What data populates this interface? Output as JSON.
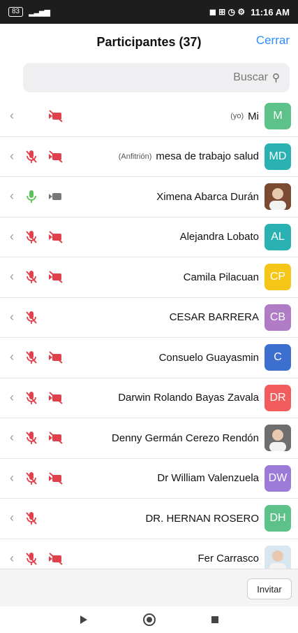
{
  "status_bar": {
    "time": "11:16 AM",
    "battery": "83"
  },
  "header": {
    "title": "Participantes (37)",
    "close_label": "Cerrar"
  },
  "search": {
    "placeholder": "Buscar"
  },
  "participants": [
    {
      "name": "Mi",
      "tag": "(yo)",
      "initials": "M",
      "color": "#5cc28a",
      "mic": "none",
      "video": "off"
    },
    {
      "name": "mesa de trabajo salud",
      "tag": "(Anfitrión)",
      "initials": "MD",
      "color": "#2ab2b2",
      "mic": "muted",
      "video": "off"
    },
    {
      "name": "Ximena Abarca Durán",
      "tag": "",
      "initials": "",
      "color": "#7a4a33",
      "photo": true,
      "mic": "on",
      "video": "on"
    },
    {
      "name": "Alejandra Lobato",
      "tag": "",
      "initials": "AL",
      "color": "#2ab2b2",
      "mic": "muted",
      "video": "off"
    },
    {
      "name": "Camila Pilacuan",
      "tag": "",
      "initials": "CP",
      "color": "#f5c518",
      "mic": "muted",
      "video": "off"
    },
    {
      "name": "CESAR BARRERA",
      "tag": "",
      "initials": "CB",
      "color": "#b07cc6",
      "mic": "muted",
      "video": "none"
    },
    {
      "name": "Consuelo Guayasmin",
      "tag": "",
      "initials": "C",
      "color": "#3d6fd1",
      "mic": "muted",
      "video": "off"
    },
    {
      "name": "Darwin Rolando Bayas Zavala",
      "tag": "",
      "initials": "DR",
      "color": "#f25c5c",
      "mic": "muted",
      "video": "off"
    },
    {
      "name": "Denny Germán Cerezo Rendón",
      "tag": "",
      "initials": "",
      "color": "#6e6e6e",
      "photo": true,
      "mic": "muted",
      "video": "off"
    },
    {
      "name": "Dr William Valenzuela",
      "tag": "",
      "initials": "DW",
      "color": "#9b7ad8",
      "mic": "muted",
      "video": "off"
    },
    {
      "name": "DR. HERNAN ROSERO",
      "tag": "",
      "initials": "DH",
      "color": "#5cc28a",
      "mic": "muted",
      "video": "none"
    },
    {
      "name": "Fer Carrasco",
      "tag": "",
      "initials": "",
      "color": "#d8e6f0",
      "photo": true,
      "mic": "muted",
      "video": "off"
    }
  ],
  "footer": {
    "invite_label": "Invitar"
  },
  "colors": {
    "accent": "#2d8cff",
    "muted": "#e0414c",
    "mic_on": "#5cc25a"
  }
}
